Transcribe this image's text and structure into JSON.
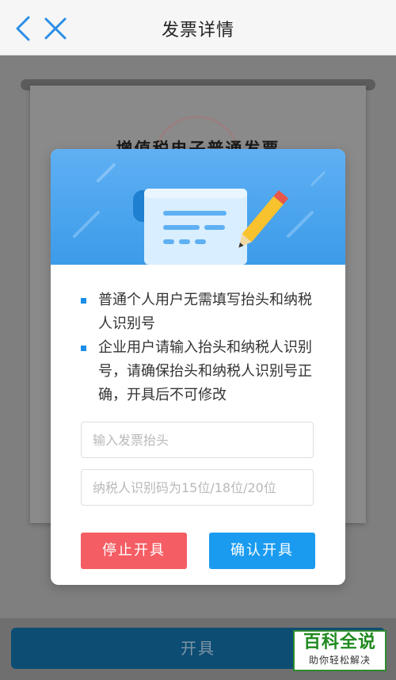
{
  "header": {
    "title": "发票详情",
    "back_icon": "chevron-left-icon",
    "close_icon": "close-icon",
    "icon_color": "#2a8ee6"
  },
  "background": {
    "invoice_title": "增值税电子普通发票"
  },
  "modal": {
    "notes": [
      "普通个人用户无需填写抬头和纳税人识别号",
      "企业用户请输入抬头和纳税人识别号，请确保抬头和纳税人识别号正确，开具后不可修改"
    ],
    "title_field": {
      "value": "",
      "placeholder": "输入发票抬头"
    },
    "taxid_field": {
      "value": "",
      "placeholder": "纳税人识别码为15位/18位/20位"
    },
    "stop_button": "停止开具",
    "confirm_button": "确认开具",
    "banner_color": "#4aa6ee",
    "stop_color": "#f45d63",
    "confirm_color": "#1a9bf0"
  },
  "bottom": {
    "issue_button": "开具"
  },
  "watermark": {
    "main": "百科全说",
    "sub": "助你轻松解决"
  }
}
